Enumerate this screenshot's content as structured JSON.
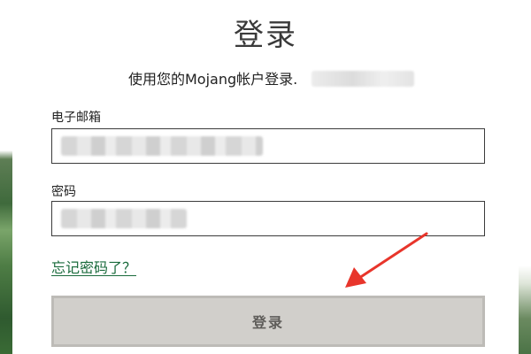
{
  "page": {
    "title": "登录",
    "subtitle": "使用您的Mojang帐户登录."
  },
  "form": {
    "email_label": "电子邮箱",
    "password_label": "密码",
    "email_value": "",
    "password_value": "",
    "forgot_link": "忘记密码了？",
    "login_button": "登录"
  },
  "colors": {
    "accent_link": "#1a6b3c",
    "button_bg": "#d1cfcb",
    "arrow": "#e8352b"
  },
  "icons": {
    "annotation": "arrow-icon"
  }
}
